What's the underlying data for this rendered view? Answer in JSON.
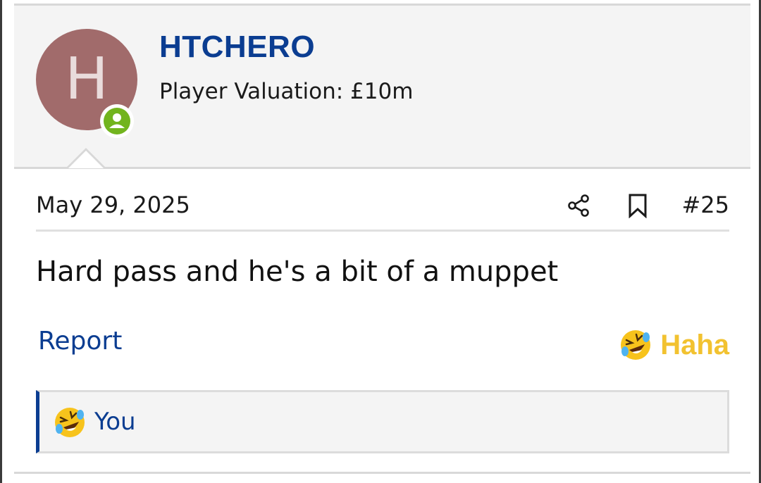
{
  "user": {
    "avatar_letter": "H",
    "avatar_color": "#a16b6b",
    "online_badge_icon": "person-icon",
    "online_color": "#72b41e",
    "username": "HTCHERO",
    "title": "Player Valuation: £10m"
  },
  "post": {
    "date": "May 29, 2025",
    "number": "#25",
    "body": "Hard pass and he's a bit of a muppet",
    "share_icon": "share-icon",
    "bookmark_icon": "bookmark-icon"
  },
  "actions": {
    "report_label": "Report",
    "reaction_label": "Haha",
    "reaction_icon": "laughing-emoji-icon",
    "reaction_color": "#f2c230"
  },
  "reactions_summary": {
    "icon": "laughing-emoji-icon",
    "text": "You"
  },
  "colors": {
    "link": "#0b3d91",
    "panel_bg": "#f4f4f4"
  }
}
